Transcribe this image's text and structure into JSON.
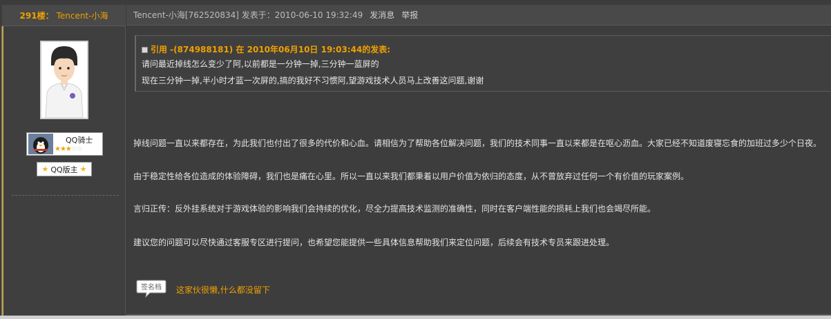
{
  "post": {
    "floor": "291楼：",
    "username": "Tencent-小海",
    "meta": "Tencent-小海[762520834] 发表于：2010-06-10 19:32:49",
    "send_message": "发消息",
    "report": "举报"
  },
  "profile": {
    "rank_name": "QQ骑士",
    "rank_stars_filled": 3,
    "rank_stars_total": 5,
    "star_filled": "★★★",
    "star_empty": "☆☆",
    "mod_badge": "QQ版主",
    "badge_star": "★"
  },
  "quote": {
    "header": "引用 -(874988181) 在 2010年06月10日 19:03:44的发表:",
    "line1": "请问最近掉线怎么变少了阿,以前都是一分钟一掉,三分钟一蓝屏的",
    "line2": "现在三分钟一掉,半小时才蓝一次屏的,搞的我好不习惯阿,望游戏技术人员马上改善这问题,谢谢"
  },
  "body": {
    "p1": "掉线问题一直以来都存在，为此我们也付出了很多的代价和心血。请相信为了帮助各位解决问题，我们的技术同事一直以来都是在呕心沥血。大家已经不知道废寝忘食的加班过多少个日夜。",
    "p2": "由于稳定性给各位造成的体验障碍，我们也是痛在心里。所以一直以来我们都秉着以用户价值为依归的态度，从不曾放弃过任何一个有价值的玩家案例。",
    "p3": "言归正传：反外挂系统对于游戏体验的影响我们会持续的优化，尽全力提高技术监测的准确性，同时在客户端性能的损耗上我们也会竭尽所能。",
    "p4": "建议您的问题可以尽快通过客服专区进行提问，也希望您能提供一些具体信息帮助我们来定位问题，后续会有技术专员来跟进处理。"
  },
  "signature": {
    "icon_label": "签名档",
    "text": "这家伙很懒,什么都没留下"
  },
  "colors": {
    "accent": "#f0a000",
    "background": "#3c3c3c",
    "text": "#e4e4e4"
  }
}
